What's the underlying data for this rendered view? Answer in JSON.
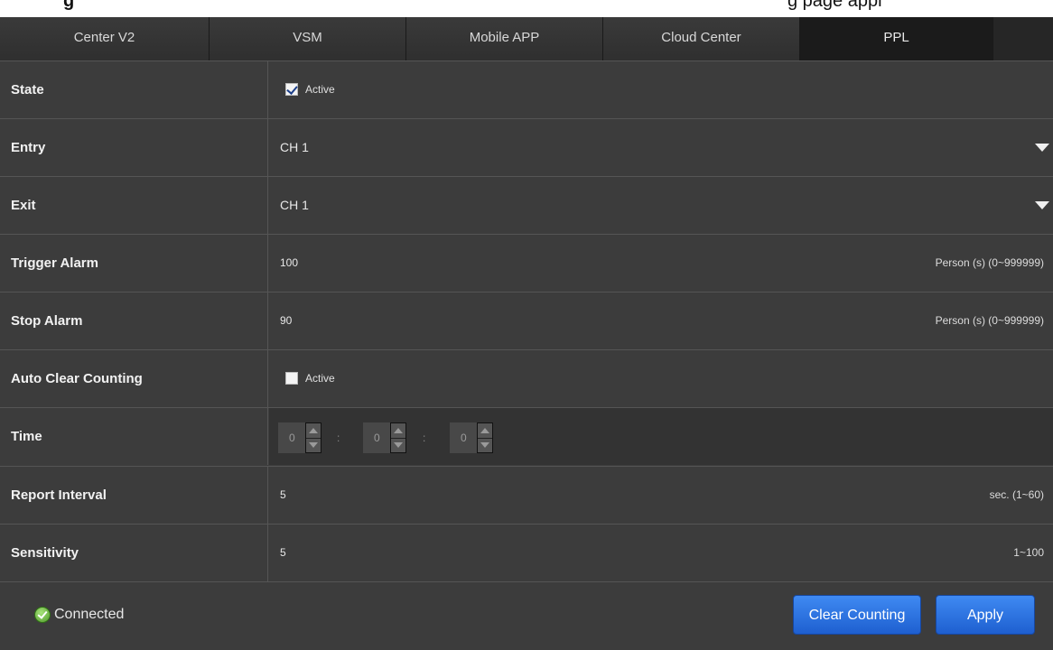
{
  "tabs": [
    {
      "label": "Center V2"
    },
    {
      "label": "VSM"
    },
    {
      "label": "Mobile APP"
    },
    {
      "label": "Cloud Center"
    },
    {
      "label": "PPL",
      "active": true
    }
  ],
  "form": {
    "state": {
      "label": "State",
      "checkbox_label": "Active",
      "checked": true
    },
    "entry": {
      "label": "Entry",
      "value": "CH 1"
    },
    "exit": {
      "label": "Exit",
      "value": "CH 1"
    },
    "trigger_alarm": {
      "label": "Trigger Alarm",
      "value": "100",
      "unit": "Person (s) (0~999999)"
    },
    "stop_alarm": {
      "label": "Stop Alarm",
      "value": "90",
      "unit": "Person (s) (0~999999)"
    },
    "auto_clear": {
      "label": "Auto Clear Counting",
      "checkbox_label": "Active",
      "checked": false
    },
    "time": {
      "label": "Time",
      "hour": "0",
      "minute": "0",
      "second": "0",
      "separator": ":"
    },
    "report_interval": {
      "label": "Report Interval",
      "value": "5",
      "unit": "sec. (1~60)"
    },
    "sensitivity": {
      "label": "Sensitivity",
      "value": "5",
      "unit": "1~100"
    }
  },
  "footer": {
    "status": "Connected",
    "clear_button": "Clear Counting",
    "apply_button": "Apply"
  },
  "colors": {
    "panel_bg": "#3c3c3c",
    "tab_active_bg": "#1b1b1b",
    "button_blue": "#2f7be8",
    "status_green": "#6fc04a"
  }
}
